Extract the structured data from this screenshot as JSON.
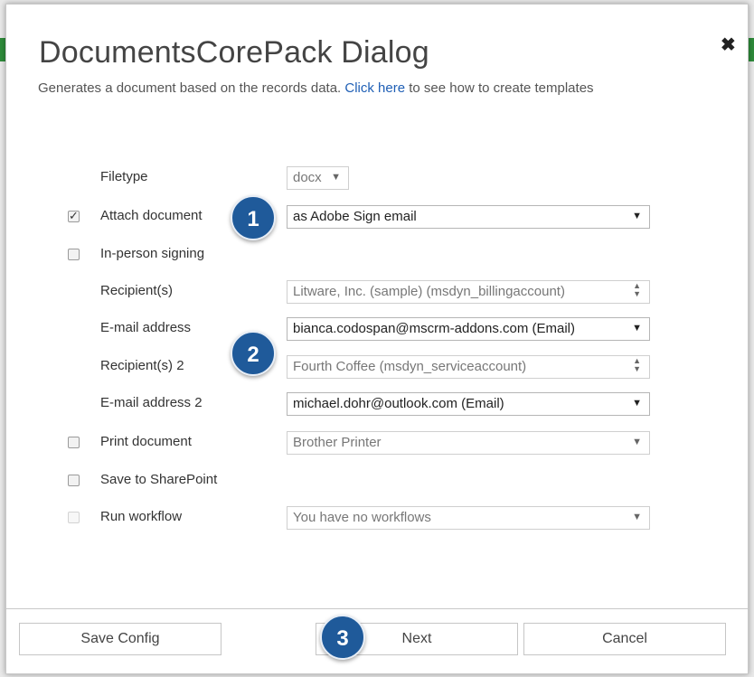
{
  "dialog": {
    "title": "DocumentsCorePack Dialog",
    "close_glyph": "✖",
    "subtitle_prefix": "Generates a document based on the records data.",
    "subtitle_link": "Click here",
    "subtitle_suffix": "to see how to create templates"
  },
  "form": {
    "filetype": {
      "label": "Filetype",
      "value": "docx"
    },
    "attach_document": {
      "label": "Attach document",
      "checked": true,
      "value": "as Adobe Sign email"
    },
    "in_person_signing": {
      "label": "In-person signing",
      "checked": false
    },
    "recipients": {
      "label": "Recipient(s)",
      "value": "Litware, Inc. (sample) (msdyn_billingaccount)"
    },
    "email_address": {
      "label": "E-mail address",
      "value": "bianca.codospan@mscrm-addons.com (Email)"
    },
    "recipients_2": {
      "label": "Recipient(s) 2",
      "value": "Fourth Coffee (msdyn_serviceaccount)"
    },
    "email_address_2": {
      "label": "E-mail address 2",
      "value": "michael.dohr@outlook.com (Email)"
    },
    "print_document": {
      "label": "Print document",
      "checked": false,
      "value": "Brother Printer"
    },
    "save_to_sharepoint": {
      "label": "Save to SharePoint",
      "checked": false
    },
    "run_workflow": {
      "label": "Run workflow",
      "checked": false,
      "value": "You have no workflows"
    }
  },
  "badges": {
    "one": "1",
    "two": "2",
    "three": "3"
  },
  "footer": {
    "save_config": "Save Config",
    "next": "Next",
    "cancel": "Cancel"
  },
  "icons": {
    "dropdown": "chevron-down-icon",
    "spinner": "up-down-arrows-icon",
    "close": "close-icon",
    "check": "checkmark-icon"
  },
  "colors": {
    "badge": "#1f5a9a",
    "link": "#1f5fb5",
    "title": "#444444"
  }
}
